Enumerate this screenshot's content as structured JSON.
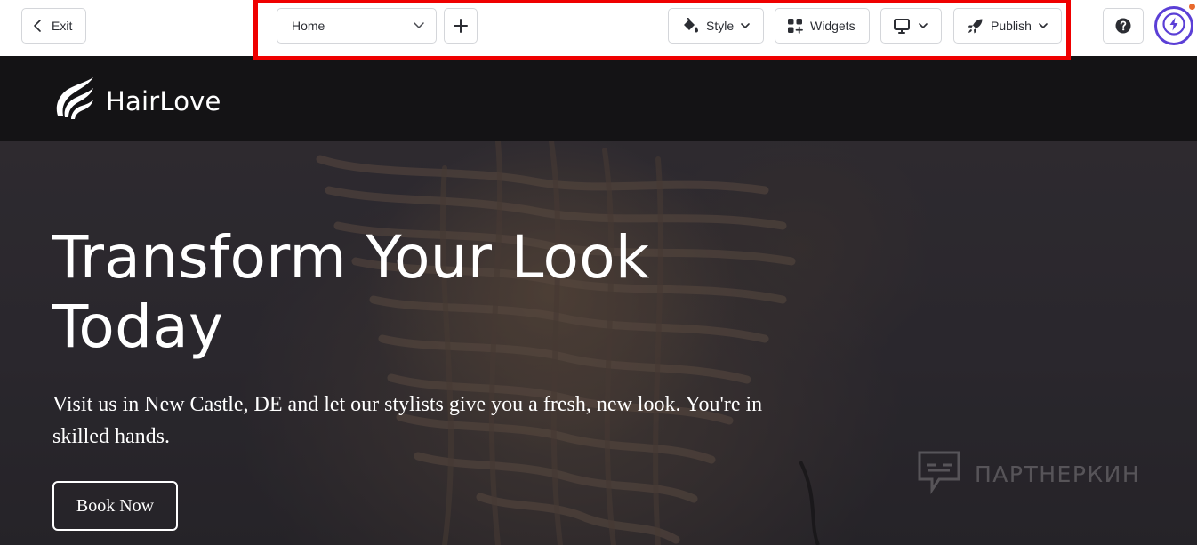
{
  "toolbar": {
    "exit_label": "Exit",
    "page_select_value": "Home",
    "style_label": "Style",
    "widgets_label": "Widgets",
    "publish_label": "Publish",
    "highlight_color": "#ef0000",
    "avatar_color": "#5b3fd6",
    "notification_color": "#e8692c"
  },
  "site": {
    "brand": "HairLove",
    "hero_title": "Transform Your Look Today",
    "hero_subtitle": "Visit us in New Castle, DE and let our stylists give you a fresh, new look. You're in skilled hands.",
    "cta_label": "Book Now"
  },
  "watermark": {
    "text": "ПАРТНЕРКИН"
  },
  "icons": [
    "chevron-left-icon",
    "chevron-down-icon",
    "plus-icon",
    "paint-bucket-icon",
    "widgets-grid-icon",
    "monitor-icon",
    "rocket-icon",
    "help-icon",
    "bolt-icon",
    "hair-logo-icon"
  ]
}
